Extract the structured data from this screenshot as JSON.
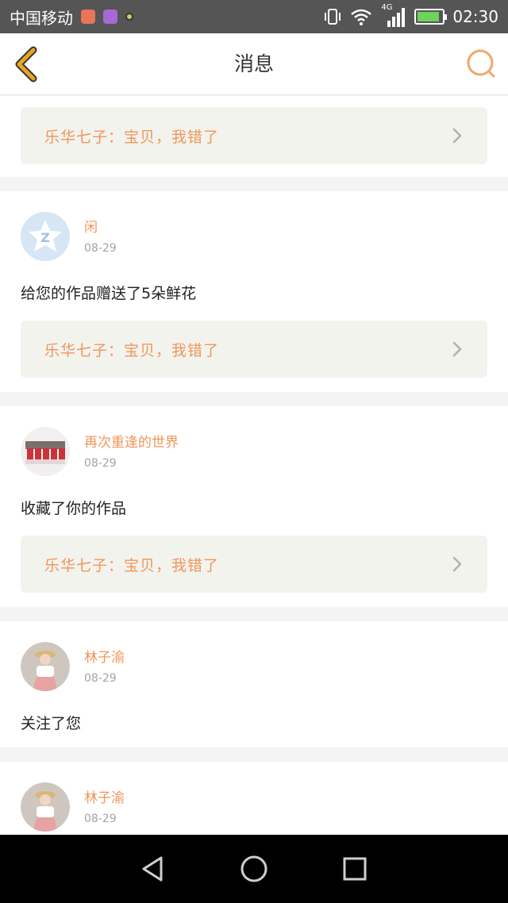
{
  "status_bar": {
    "carrier": "中国移动",
    "network": "4G",
    "time": "02:30",
    "battery_percent": 0.9
  },
  "header": {
    "title": "消息"
  },
  "colors": {
    "accent": "#f0955b",
    "back_icon": "#e6a623",
    "search_icon": "#f3a76a",
    "quote_bg": "#f3f3ee"
  },
  "messages": [
    {
      "type": "quote_only",
      "quote": "乐华七子：宝贝，我错了"
    },
    {
      "user": "闲",
      "date": "08-29",
      "text": "给您的作品赠送了5朵鲜花",
      "quote": "乐华七子：宝贝，我错了",
      "avatar_icon": "star-z-icon"
    },
    {
      "user": "再次重逢的世界",
      "date": "08-29",
      "text": "收藏了你的作品",
      "quote": "乐华七子：宝贝，我错了",
      "avatar_icon": "group-photo-avatar"
    },
    {
      "user": "林子渝",
      "date": "08-29",
      "text": "关注了您",
      "avatar_icon": "girl-photo-avatar"
    },
    {
      "user": "林子渝",
      "date": "08-29",
      "avatar_icon": "girl-photo-avatar"
    }
  ],
  "nav_bar": {
    "icons": [
      "back-triangle-icon",
      "home-circle-icon",
      "recents-square-icon"
    ]
  }
}
